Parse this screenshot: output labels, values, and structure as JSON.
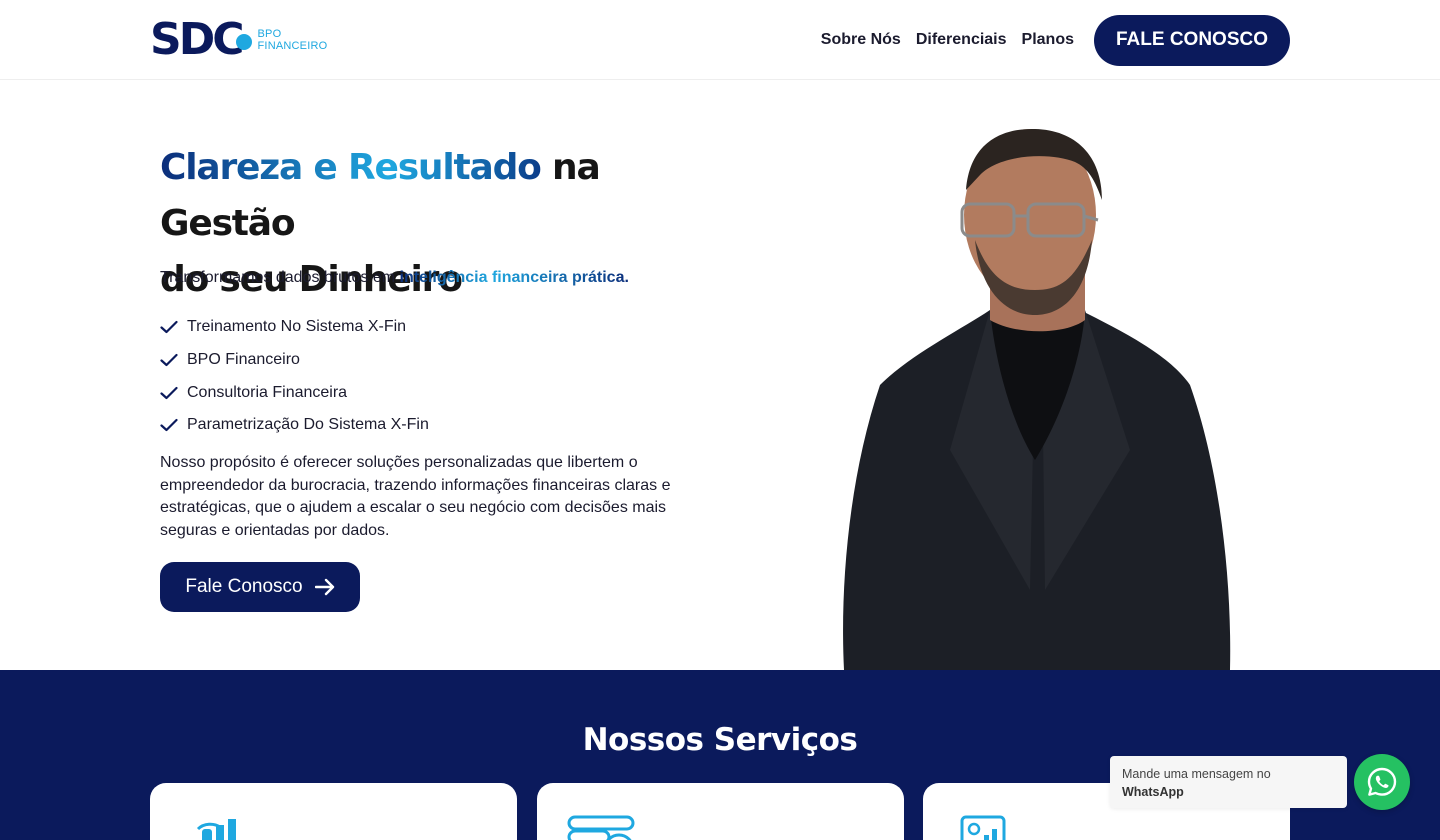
{
  "header": {
    "logo_text": "SDC",
    "logo_sub_1": "BPO",
    "logo_sub_2": "FINANCEIRO",
    "nav": [
      "Sobre Nós",
      "Diferenciais",
      "Planos"
    ],
    "cta": "FALE CONOSCO"
  },
  "hero": {
    "title_highlight": "Clareza e Resultado",
    "title_rest_1": " na Gestão",
    "title_rest_2": "do seu Dinheiro",
    "intro": "Transformamos dados brutos em ",
    "intro_highlight": "inteligência financeira prática.",
    "checklist": [
      "Treinamento No Sistema X-Fin",
      "BPO Financeiro",
      "Consultoria Financeira",
      "Parametrização Do Sistema X-Fin"
    ],
    "description": "Nosso propósito é oferecer soluções personalizadas que libertem o empreendedor da burocracia, trazendo informações financeiras claras e estratégicas, que o ajudem a escalar o seu negócio com decisões mais seguras e orientadas por dados.",
    "button": "Fale Conosco"
  },
  "services": {
    "title": "Nossos Serviços"
  },
  "whatsapp": {
    "line1": "Mande uma mensagem no",
    "line2": "WhatsApp"
  },
  "colors": {
    "navy": "#0b1a5c",
    "accent": "#1fa8e0",
    "whatsapp": "#25c162"
  }
}
